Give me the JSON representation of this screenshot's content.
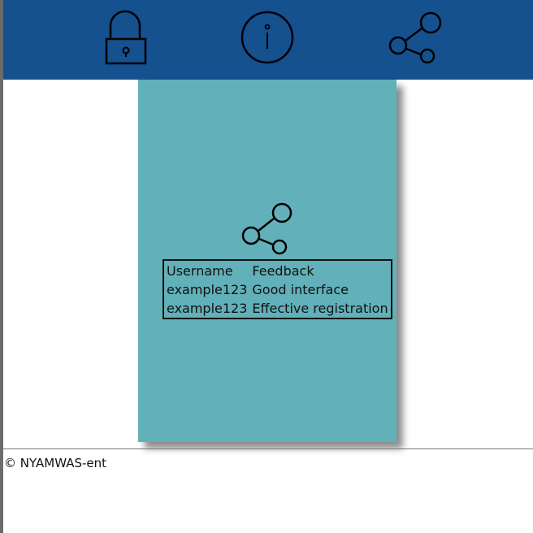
{
  "header": {
    "bg_color": "#15508f",
    "icons": [
      "lock-icon",
      "info-icon",
      "share-icon"
    ]
  },
  "card": {
    "bg_color": "#62b0b9",
    "icon": "share-icon",
    "table": {
      "headers": [
        "Username",
        "Feedback"
      ],
      "rows": [
        [
          "example123",
          "Good interface"
        ],
        [
          "example123",
          "Effective registration"
        ]
      ]
    }
  },
  "footer": {
    "copyright": "© NYAMWAS-ent"
  }
}
